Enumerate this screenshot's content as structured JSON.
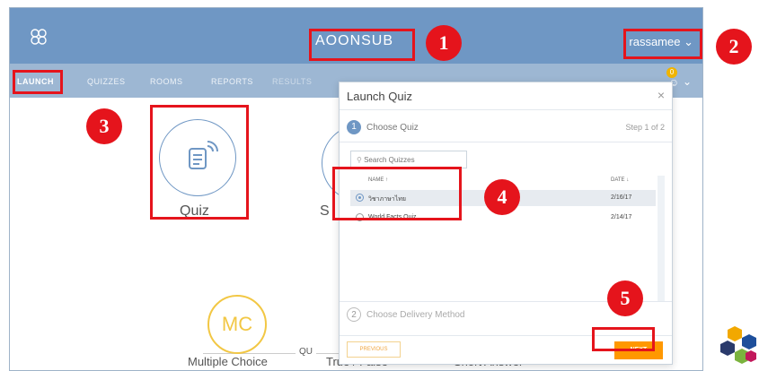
{
  "app": {
    "title": "AOONSUB",
    "user": "rassamee",
    "notification_count": "0",
    "nav": [
      {
        "label": "LAUNCH",
        "active": true
      },
      {
        "label": "QUIZZES"
      },
      {
        "label": "ROOMS"
      },
      {
        "label": "REPORTS"
      },
      {
        "label": "RESULTS"
      }
    ]
  },
  "launch": {
    "quiz_label": "Quiz",
    "space_label": "S",
    "quick_question_heading": "QU",
    "options": [
      {
        "icon_text": "MC",
        "label": "Multiple Choice"
      },
      {
        "label": "True / False"
      },
      {
        "label": "Short Answer"
      }
    ]
  },
  "modal": {
    "title": "Launch Quiz",
    "step1_number": "1",
    "step1_label": "Choose Quiz",
    "step_count": "Step 1 of 2",
    "search_placeholder": "Search Quizzes",
    "col_name": "NAME ↑",
    "col_date": "DATE ↓",
    "rows": [
      {
        "name": "วิชาภาษาไทย",
        "date": "2/16/17",
        "selected": true
      },
      {
        "name": "World Facts Quiz",
        "date": "2/14/17",
        "selected": false
      }
    ],
    "step2_number": "2",
    "step2_label": "Choose Delivery Method",
    "prev_label": "PREVIOUS",
    "next_label": "NEXT"
  },
  "annotations": [
    "1",
    "2",
    "3",
    "4",
    "5"
  ],
  "colors": {
    "header": "#6f97c4",
    "nav": "#9db7d3",
    "highlight": "#e5141c",
    "next": "#ff9800",
    "mc": "#f2c744"
  }
}
